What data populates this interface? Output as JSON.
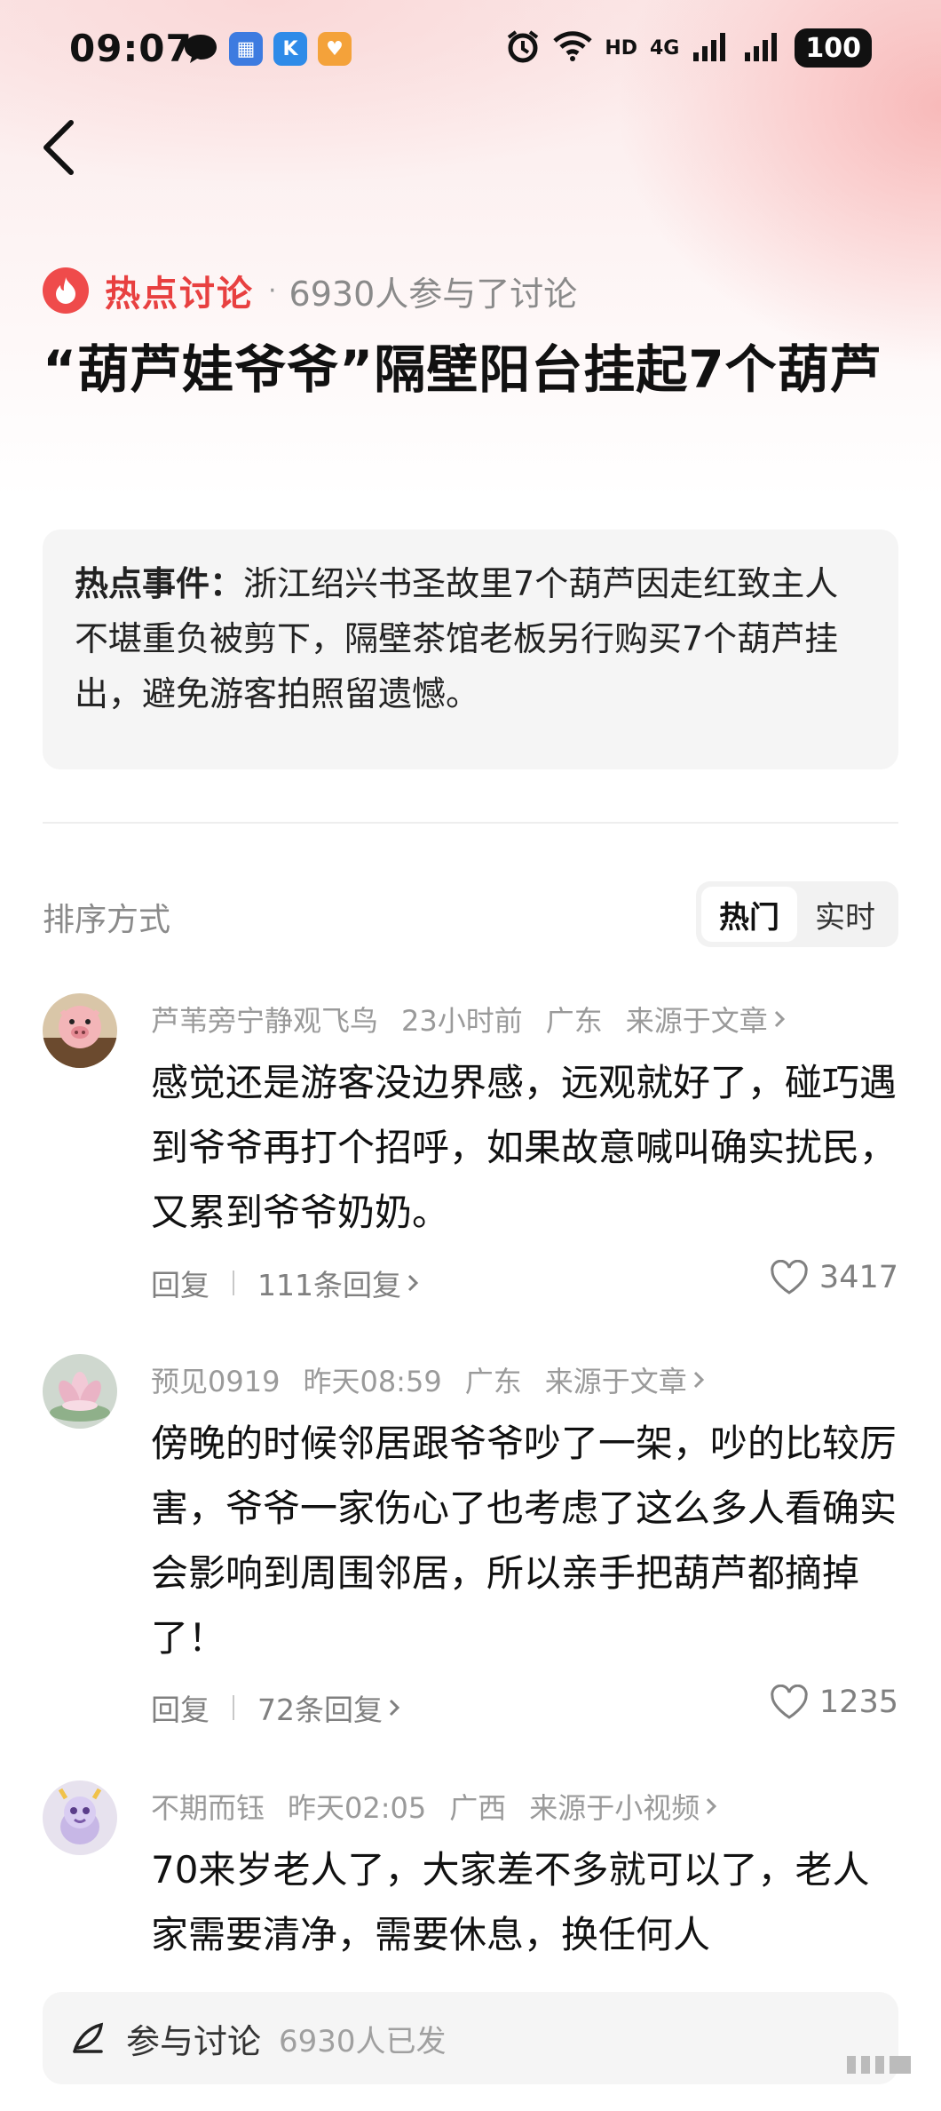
{
  "status_bar": {
    "time": "09:07",
    "network": "4G",
    "hd": "HD",
    "battery": "100",
    "left_icons": [
      "message-icon",
      "app-icon-blue",
      "app-icon-k",
      "app-icon-heart"
    ],
    "right_icons": [
      "alarm-icon",
      "wifi-icon",
      "signal-icon"
    ]
  },
  "topic": {
    "tag": "热点讨论",
    "dot": "·",
    "participants": "6930人参与了讨论",
    "title": "“葫芦娃爷爷”隔壁阳台挂起7个葫芦"
  },
  "event": {
    "label": "热点事件：",
    "text": "浙江绍兴书圣故里7个葫芦因走红致主人不堪重负被剪下，隔壁茶馆老板另行购买7个葫芦挂出，避免游客拍照留遗憾。"
  },
  "sort": {
    "label": "排序方式",
    "options": [
      "热门",
      "实时"
    ],
    "active": "热门"
  },
  "comments": [
    {
      "user": "芦苇旁宁静观飞鸟",
      "time": "23小时前",
      "location": "广东",
      "source": "来源于文章",
      "text": "感觉还是游客没边界感，远观就好了，碰巧遇到爷爷再打个招呼，如果故意喊叫确实扰民，又累到爷爷奶奶。",
      "reply_label": "回复",
      "reply_count": "111条回复",
      "likes": "3417"
    },
    {
      "user": "预见0919",
      "time": "昨天08:59",
      "location": "广东",
      "source": "来源于文章",
      "text": "傍晚的时候邻居跟爷爷吵了一架，吵的比较厉害，爷爷一家伤心了也考虑了这么多人看确实会影响到周围邻居，所以亲手把葫芦都摘掉了！",
      "reply_label": "回复",
      "reply_count": "72条回复",
      "likes": "1235"
    },
    {
      "user": "不期而钰",
      "time": "昨天02:05",
      "location": "广西",
      "source": "来源于小视频",
      "text": "70来岁老人了，大家差不多就可以了，老人家需要清净，需要休息，换任何人"
    }
  ],
  "bottom": {
    "join_label": "参与讨论",
    "sent_count": "6930人已发"
  },
  "colors": {
    "accent": "#e84040",
    "secondary_text": "#9a9a9a",
    "box_bg": "#f5f5f5"
  }
}
